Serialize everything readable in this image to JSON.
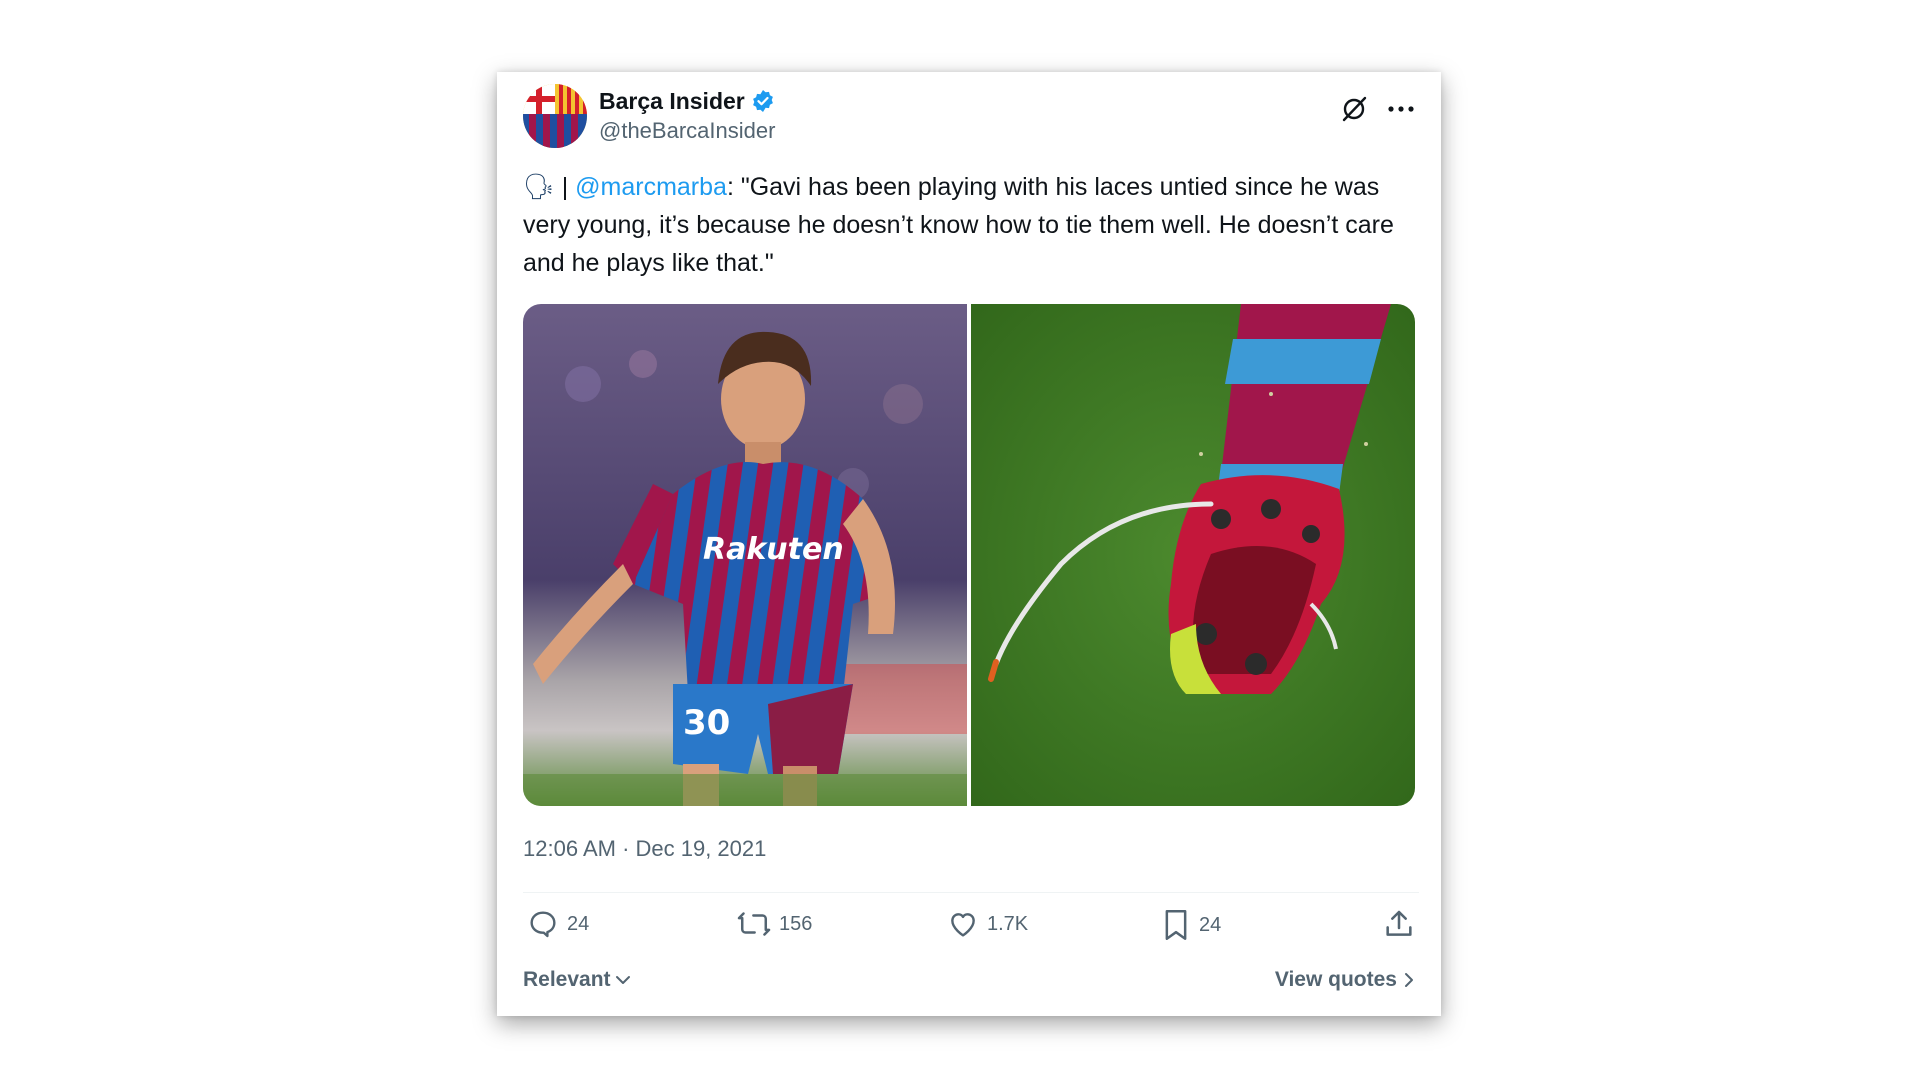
{
  "author": {
    "display_name": "Barça Insider",
    "handle": "@theBarcaInsider",
    "verified_badge_icon": "verified-badge-icon"
  },
  "tweet": {
    "speaker_emoji": "🗣",
    "separator": " | ",
    "mention": "@marcmarba",
    "body": ": \"Gavi has been playing with his laces untied since he was very young, it’s because he doesn’t know how to tie them well. He doesn’t care and he plays like that.\""
  },
  "media": {
    "left_image_icon": "player-photo",
    "right_image_icon": "boot-laces-photo"
  },
  "timestamp": "12:06 AM · Dec 19, 2021",
  "actions": {
    "replies": "24",
    "reposts": "156",
    "likes": "1.7K",
    "bookmarks": "24"
  },
  "footer": {
    "sort_label": "Relevant",
    "view_quotes_label": "View quotes"
  },
  "colors": {
    "accent": "#1d9bf0",
    "text": "#0f1419",
    "muted": "#536471",
    "barca_blue": "#1f5fb3",
    "barca_red": "#a1164b"
  }
}
